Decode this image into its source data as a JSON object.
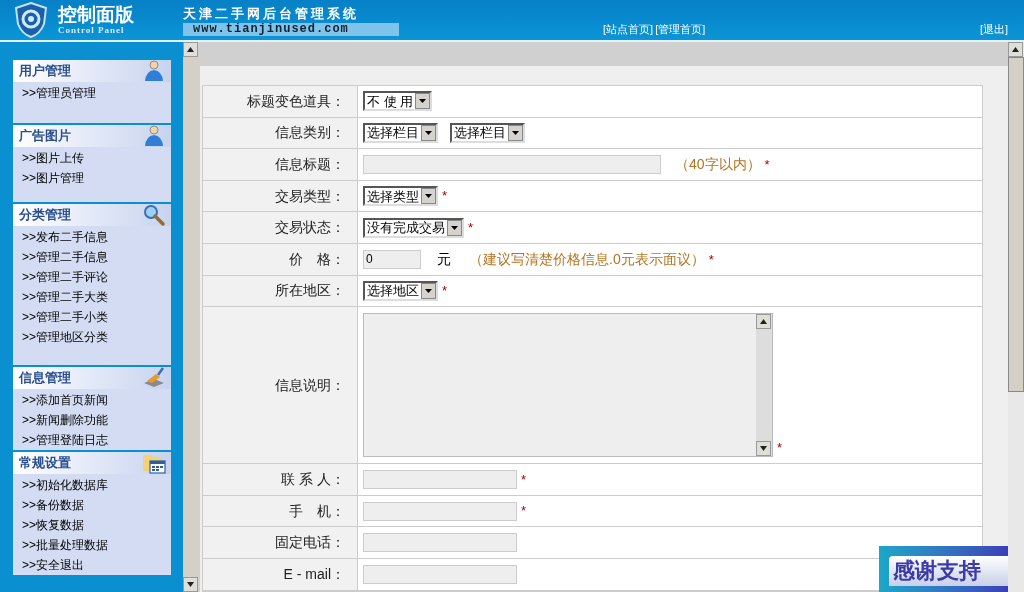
{
  "header": {
    "logo_title": "控制面版",
    "logo_subtitle": "Control Panel",
    "site_title": "天津二手网后台管理系统",
    "site_url": "www.tianjinused.com",
    "links": [
      "[站点首页]",
      "[管理首页]"
    ],
    "logout": "[退出]"
  },
  "sidebar": {
    "sections": [
      {
        "title": "用户管理",
        "items": [
          ">>管理员管理"
        ]
      },
      {
        "title": "广告图片",
        "items": [
          ">>图片上传",
          ">>图片管理"
        ]
      },
      {
        "title": "分类管理",
        "items": [
          ">>发布二手信息",
          ">>管理二手信息",
          ">>管理二手评论",
          ">>管理二手大类",
          ">>管理二手小类",
          ">>管理地区分类"
        ]
      },
      {
        "title": "信息管理",
        "items": [
          ">>添加首页新闻",
          ">>新闻删除功能",
          ">>管理登陆日志"
        ]
      },
      {
        "title": "常规设置",
        "items": [
          ">>初始化数据库",
          ">>备份数据",
          ">>恢复数据",
          ">>批量处理数据",
          ">>安全退出"
        ]
      }
    ]
  },
  "form": {
    "rows": [
      {
        "label": "标题变色道具：",
        "controls": [
          {
            "kind": "select",
            "value": "不 使 用"
          }
        ]
      },
      {
        "label": "信息类别：",
        "controls": [
          {
            "kind": "select",
            "value": "选择栏目"
          },
          {
            "kind": "select",
            "value": "选择栏目"
          }
        ]
      },
      {
        "label": "信息标题：",
        "controls": [
          {
            "kind": "wide_input"
          },
          {
            "kind": "hint",
            "text": "（40字以内）"
          },
          {
            "kind": "required",
            "text": "*"
          }
        ]
      },
      {
        "label": "交易类型：",
        "controls": [
          {
            "kind": "select",
            "value": "选择类型"
          },
          {
            "kind": "required",
            "text": "*"
          }
        ]
      },
      {
        "label": "交易状态：",
        "controls": [
          {
            "kind": "select",
            "value": "没有完成交易"
          },
          {
            "kind": "required",
            "text": "*"
          }
        ]
      },
      {
        "label": "价　格：",
        "controls": [
          {
            "kind": "small_input",
            "value": "0"
          },
          {
            "kind": "unit",
            "text": "元"
          },
          {
            "kind": "hint",
            "text": "（建议写清楚价格信息.0元表示面议）"
          },
          {
            "kind": "required",
            "text": "*"
          }
        ]
      },
      {
        "label": "所在地区：",
        "controls": [
          {
            "kind": "select",
            "value": "选择地区"
          },
          {
            "kind": "required",
            "text": "*"
          }
        ]
      },
      {
        "label": "信息说明：",
        "controls": [
          {
            "kind": "textarea"
          },
          {
            "kind": "required",
            "text": "*"
          }
        ]
      },
      {
        "label": "联 系 人：",
        "controls": [
          {
            "kind": "input"
          },
          {
            "kind": "required",
            "text": "*"
          }
        ]
      },
      {
        "label": "手　机：",
        "controls": [
          {
            "kind": "input"
          },
          {
            "kind": "required",
            "text": "*"
          }
        ]
      },
      {
        "label": "固定电话：",
        "controls": [
          {
            "kind": "input"
          }
        ]
      },
      {
        "label": "E - mail：",
        "controls": [
          {
            "kind": "input"
          }
        ]
      }
    ]
  },
  "thanks_badge": "感谢支持"
}
